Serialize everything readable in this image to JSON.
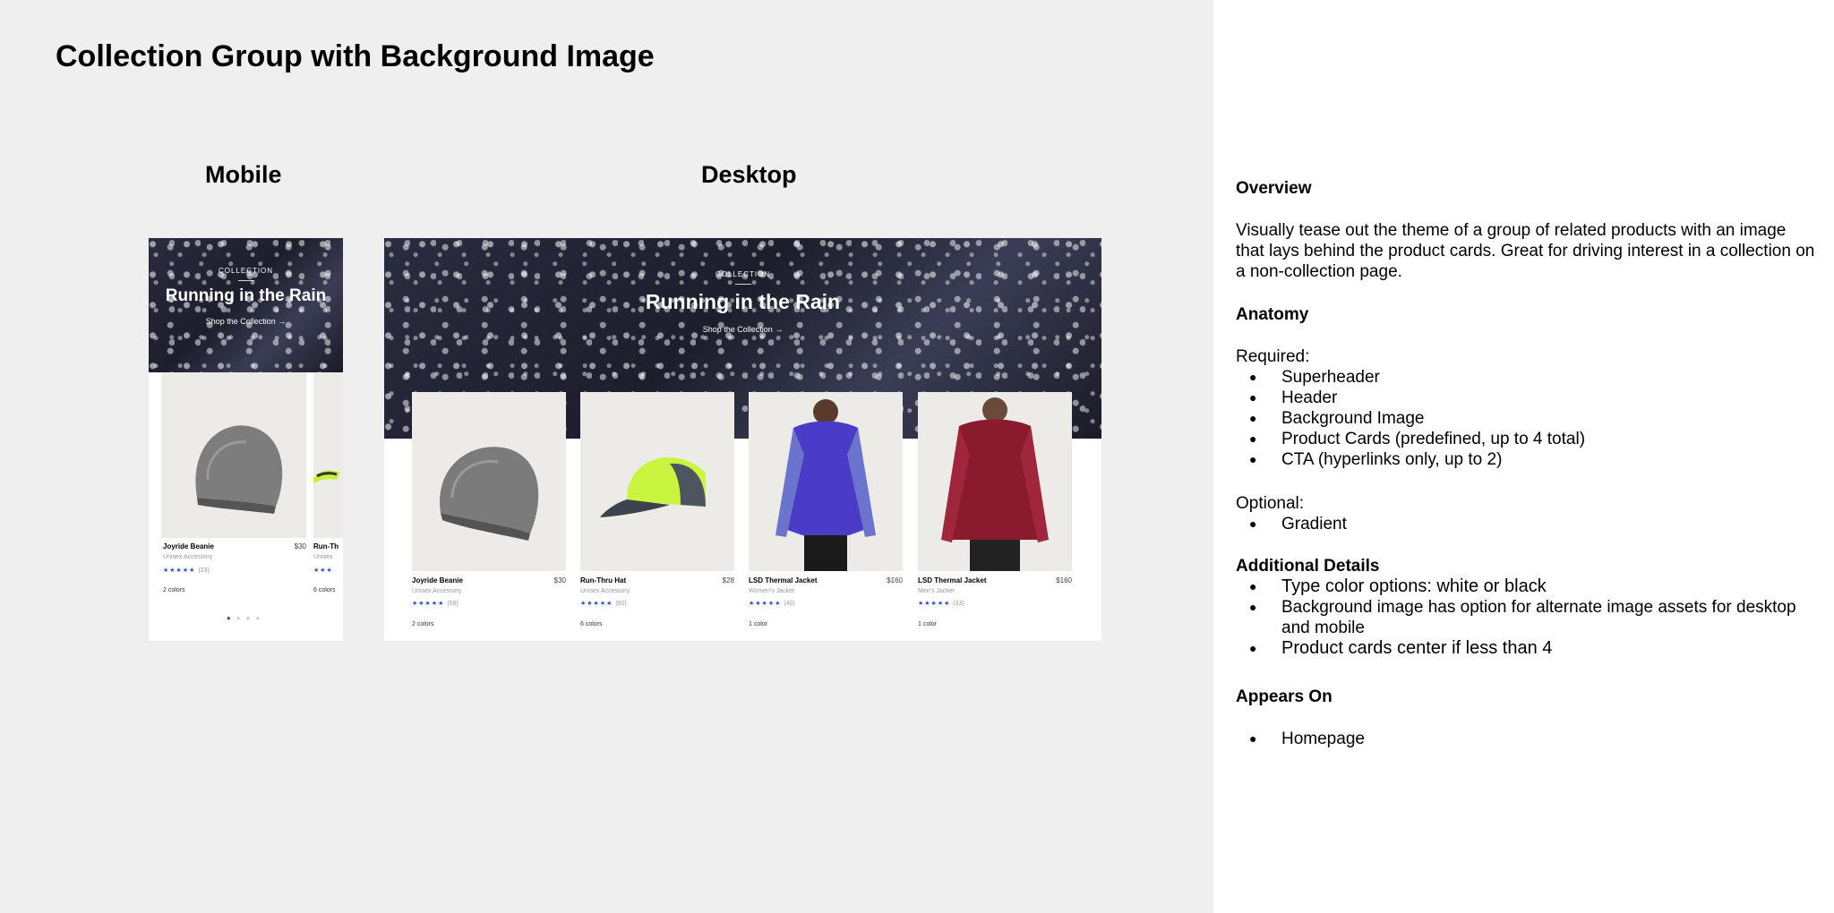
{
  "page": {
    "title": "Collection Group with Background Image"
  },
  "labels": {
    "mobile": "Mobile",
    "desktop": "Desktop"
  },
  "hero": {
    "superheader": "COLLECTION",
    "header": "Running in the Rain",
    "cta": "Shop the Collection →"
  },
  "products": [
    {
      "name": "Joyride Beanie",
      "price": "$30",
      "category": "Unisex Accessory",
      "stars": "★★★★★",
      "reviews": "(59)",
      "colors": "2 colors"
    },
    {
      "name": "Run-Thru Hat",
      "price": "$28",
      "category": "Unisex Accessory",
      "stars": "★★★★★",
      "reviews": "(60)",
      "colors": "6 colors"
    },
    {
      "name": "LSD Thermal Jacket",
      "price": "$160",
      "category": "Women's Jacket",
      "stars": "★★★★★",
      "reviews": "(40)",
      "colors": "1 color"
    },
    {
      "name": "LSD Thermal Jacket",
      "price": "$160",
      "category": "Men's Jacket",
      "stars": "★★★★★",
      "reviews": "(33)",
      "colors": "1 color"
    }
  ],
  "mobile": {
    "card1": {
      "name": "Joyride Beanie",
      "price": "$30",
      "category": "Unisex Accessory",
      "stars": "★★★★★",
      "reviews": "(23)",
      "colors": "2 colors"
    },
    "card2": {
      "name": "Run-Th",
      "category": "Unisex",
      "stars": "★★★",
      "colors": "6 colors"
    }
  },
  "sidebar": {
    "overview_heading": "Overview",
    "overview_text": "Visually tease out the theme of a group of related products with an image that lays behind the product cards. Great for driving interest in a collection on a non-collection page.",
    "anatomy_heading": "Anatomy",
    "required_label": "Required:",
    "required_items": [
      "Superheader",
      "Header",
      "Background Image",
      "Product Cards (predefined, up to 4 total)",
      "CTA (hyperlinks only, up to 2)"
    ],
    "optional_label": "Optional:",
    "optional_items": [
      "Gradient"
    ],
    "details_heading": "Additional Details",
    "details_items": [
      "Type color options: white or black",
      "Background image has option for alternate image assets for desktop and mobile",
      "Product cards center if less than 4"
    ],
    "appears_heading": "Appears On",
    "appears_items": [
      "Homepage"
    ]
  }
}
